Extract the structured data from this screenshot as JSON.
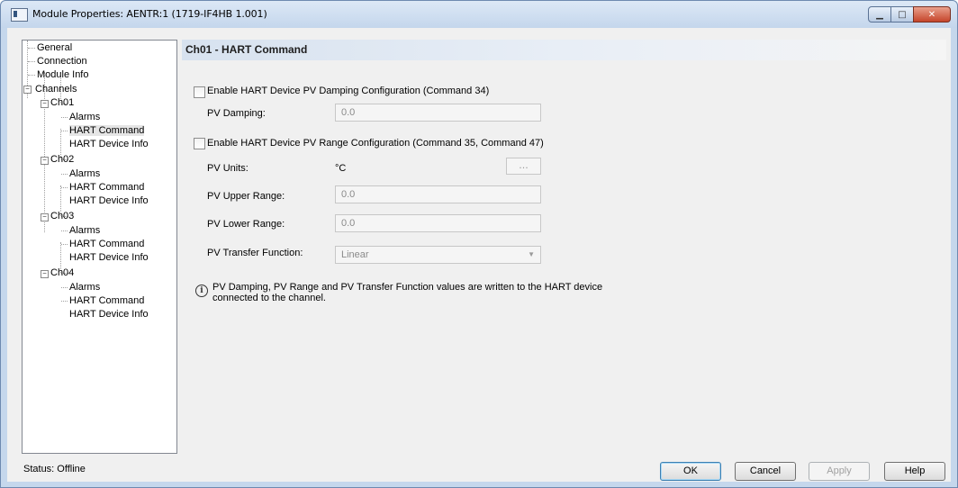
{
  "window": {
    "title": "Module Properties: AENTR:1 (1719-IF4HB 1.001)",
    "minimize_glyph": "▁",
    "maximize_glyph": "□",
    "close_glyph": "✕"
  },
  "tree": {
    "items": [
      {
        "label": "General"
      },
      {
        "label": "Connection"
      },
      {
        "label": "Module Info"
      },
      {
        "label": "Channels"
      },
      {
        "label": "Ch01"
      },
      {
        "label": "Alarms"
      },
      {
        "label": "HART Command",
        "selected": true
      },
      {
        "label": "HART Device Info"
      },
      {
        "label": "Ch02"
      },
      {
        "label": "Alarms"
      },
      {
        "label": "HART Command"
      },
      {
        "label": "HART Device Info"
      },
      {
        "label": "Ch03"
      },
      {
        "label": "Alarms"
      },
      {
        "label": "HART Command"
      },
      {
        "label": "HART Device Info"
      },
      {
        "label": "Ch04"
      },
      {
        "label": "Alarms"
      },
      {
        "label": "HART Command"
      },
      {
        "label": "HART Device Info"
      }
    ],
    "collapse_glyph": "−"
  },
  "panel": {
    "title": "Ch01 - HART Command",
    "damping_checkbox_label": "Enable HART Device PV Damping Configuration (Command 34)",
    "damping_checked": false,
    "pv_damping_label": "PV Damping:",
    "pv_damping_value": "0.0",
    "range_checkbox_label": "Enable HART Device PV Range Configuration (Command 35, Command 47)",
    "range_checked": false,
    "pv_units_label": "PV Units:",
    "pv_units_value": "°C",
    "browse_label": "...",
    "pv_upper_label": "PV Upper Range:",
    "pv_upper_value": "0.0",
    "pv_lower_label": "PV Lower Range:",
    "pv_lower_value": "0.0",
    "pv_transfer_label": "PV Transfer Function:",
    "pv_transfer_value": "Linear",
    "info_glyph": "i",
    "info_line1": "PV Damping, PV Range and PV Transfer Function values are written to the HART device",
    "info_line2": "connected to the channel."
  },
  "footer": {
    "status": "Status:  Offline",
    "ok": "OK",
    "cancel": "Cancel",
    "apply": "Apply",
    "help": "Help"
  },
  "icons": {
    "title_icon": "window-app-icon",
    "info_icon": "info-icon",
    "dropdown_icon": "chevron-down-icon"
  },
  "colors": {
    "titlebar": "#c4d6ec",
    "close_button": "#c5452b",
    "header_gradient_start": "#d7e2ef"
  }
}
